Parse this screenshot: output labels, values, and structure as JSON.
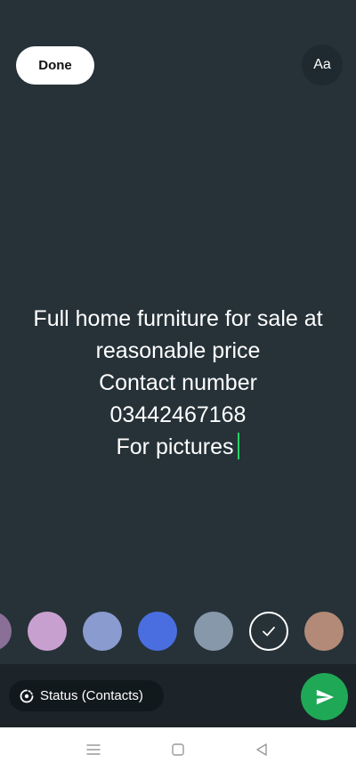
{
  "toolbar": {
    "done_label": "Done",
    "font_label": "Aa"
  },
  "status_text": {
    "lines": [
      "Full home furniture for sale at",
      "reasonable price",
      "Contact number",
      "03442467168",
      "For pictures"
    ]
  },
  "palette": {
    "colors": [
      "#8a6f96",
      "#c8a0cf",
      "#8a9bd0",
      "#4a6ee0",
      "#8898ab",
      "#263238",
      "#b38a78"
    ],
    "selected_index": 5
  },
  "bottom": {
    "audience_label": "Status (Contacts)",
    "send_icon": "send-icon",
    "accent": "#1fa855"
  },
  "nav": {
    "icons": [
      "menu-icon",
      "home-icon",
      "back-icon"
    ]
  },
  "theme": {
    "canvas_bg": "#263238",
    "cursor_color": "#25d366"
  }
}
